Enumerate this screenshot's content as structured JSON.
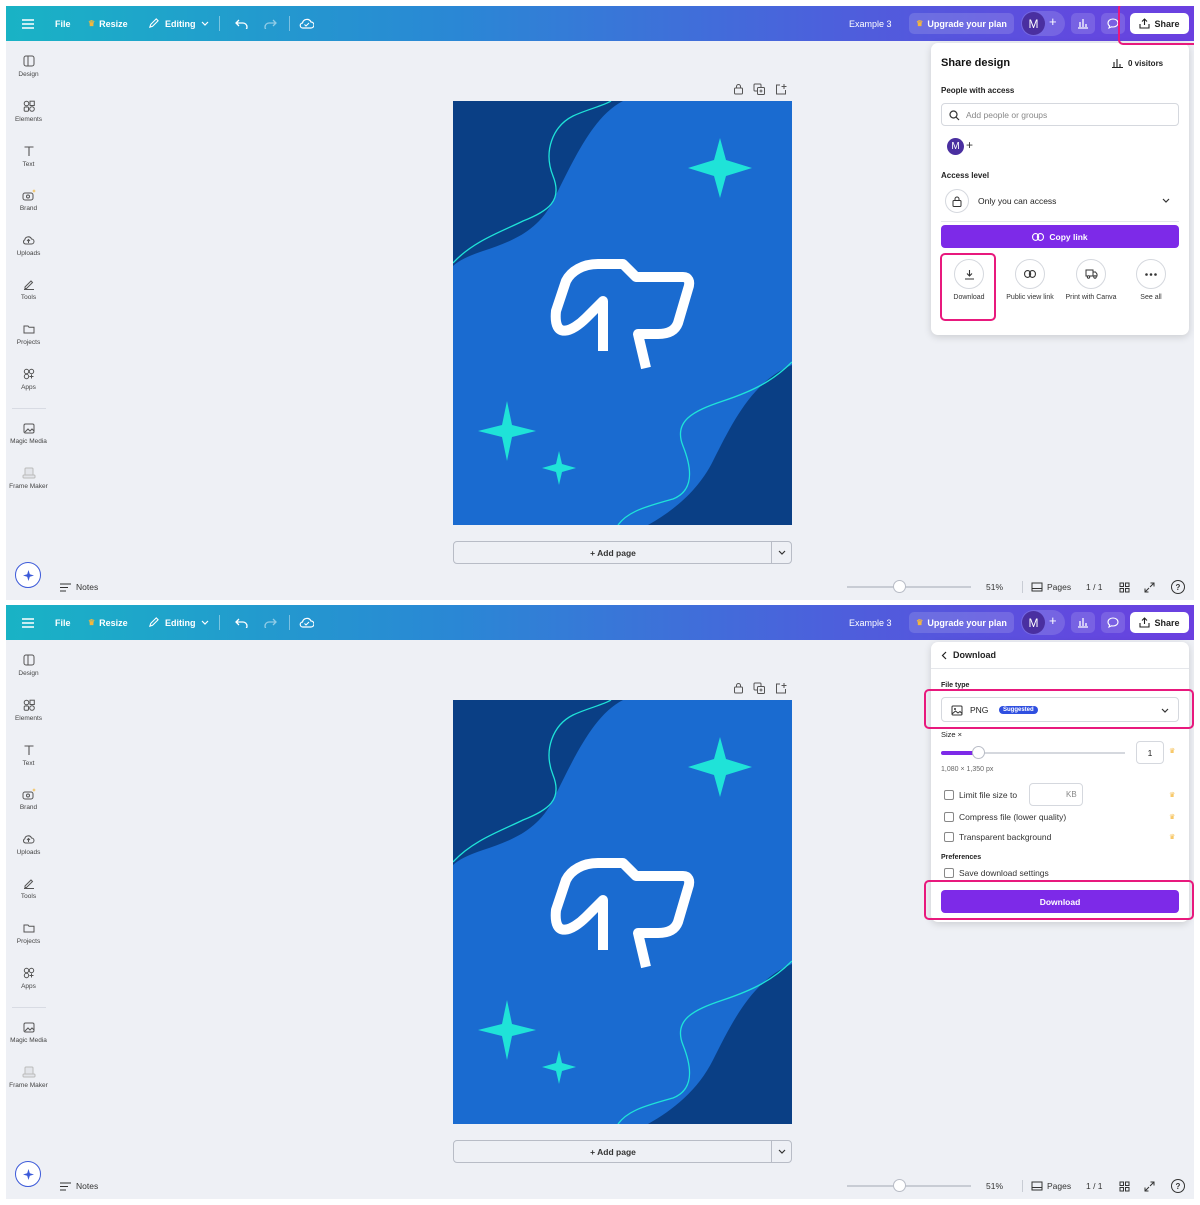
{
  "colors": {
    "accent_purple": "#7d2ae8",
    "highlight": "#e8197d",
    "design_blue": "#1a6bd0",
    "design_dark_blue": "#0a3f85",
    "design_cyan": "#1fe3d8",
    "premium_gold": "#f5b73b"
  },
  "topbar": {
    "menu_icon": "hamburger-icon",
    "file": "File",
    "resize": "Resize",
    "editing": "Editing",
    "title": "Example 3",
    "upgrade": "Upgrade your plan",
    "avatar_initial": "M",
    "add_icon": "+",
    "share": "Share"
  },
  "sidebar": {
    "items": [
      {
        "label": "Design",
        "icon": "design-icon"
      },
      {
        "label": "Elements",
        "icon": "elements-icon"
      },
      {
        "label": "Text",
        "icon": "text-icon"
      },
      {
        "label": "Brand",
        "icon": "brand-icon"
      },
      {
        "label": "Uploads",
        "icon": "uploads-icon"
      },
      {
        "label": "Tools",
        "icon": "tools-icon"
      },
      {
        "label": "Projects",
        "icon": "projects-icon"
      },
      {
        "label": "Apps",
        "icon": "apps-icon"
      },
      {
        "label": "Magic Media",
        "icon": "magic-media-icon"
      },
      {
        "label": "Frame Maker",
        "icon": "frame-maker-icon"
      }
    ]
  },
  "canvas": {
    "add_page": "+ Add page"
  },
  "bottombar": {
    "notes": "Notes",
    "zoom": "51%",
    "pages": "Pages",
    "page_count": "1 / 1",
    "help": "?"
  },
  "share_panel": {
    "title": "Share design",
    "visitors": "0 visitors",
    "people_label": "People with access",
    "search_placeholder": "Add people or groups",
    "avatar_initial": "M",
    "access_label": "Access level",
    "access_value": "Only you can access",
    "copy_link": "Copy link",
    "options": [
      {
        "label": "Download",
        "icon": "download-icon"
      },
      {
        "label": "Public view link",
        "icon": "link-icon"
      },
      {
        "label": "Print with Canva",
        "icon": "truck-icon"
      },
      {
        "label": "See all",
        "icon": "more-icon"
      }
    ]
  },
  "download_panel": {
    "back": "Download",
    "file_type_label": "File type",
    "file_type": "PNG",
    "suggested": "Suggested",
    "size_label": "Size ×",
    "size_value": "1",
    "size_slider_fraction": 0.2,
    "dimensions": "1,080 × 1,350 px",
    "limit_size": "Limit file size to",
    "kb": "KB",
    "compress": "Compress file (lower quality)",
    "transparent": "Transparent background",
    "preferences_label": "Preferences",
    "save_settings": "Save download settings",
    "download_button": "Download"
  }
}
